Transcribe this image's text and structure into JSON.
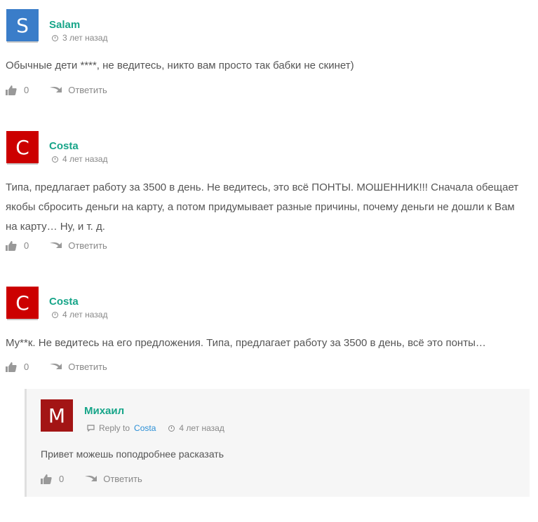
{
  "comments": [
    {
      "author": "Salam",
      "avatar_letter": "S",
      "avatar_color": "#3a7dc9",
      "time": "3 лет назад",
      "text": "Обычные дети ****, не ведитесь, никто вам просто так бабки не скинет)",
      "likes": "0",
      "reply_label": "Ответить"
    },
    {
      "author": "Costa",
      "avatar_letter": "C",
      "avatar_color": "#cc0000",
      "time": "4 лет назад",
      "text": "Типа, предлагает работу за 3500 в день. Не ведитесь, это всё ПОНТЫ. МОШЕННИК!!! Сначала обещает якобы сбросить деньги на карту, а потом придумывает разные причины, почему деньги не дошли к Вам на карту… Ну, и т. д.",
      "likes": "0",
      "reply_label": "Ответить"
    },
    {
      "author": "Costa",
      "avatar_letter": "C",
      "avatar_color": "#cc0000",
      "time": "4 лет назад",
      "text": "Му**к. Не ведитесь на его предложения. Типа, предлагает работу за 3500 в день, всё это понты…",
      "likes": "0",
      "reply_label": "Ответить"
    }
  ],
  "reply": {
    "author": "Михаил",
    "avatar_letter": "M",
    "avatar_color": "#a31515",
    "reply_to_label": "Reply to",
    "reply_to_name": "Costa",
    "time": "4 лет назад",
    "text": "Привет можешь поподробнее расказать",
    "likes": "0",
    "reply_label": "Ответить"
  }
}
